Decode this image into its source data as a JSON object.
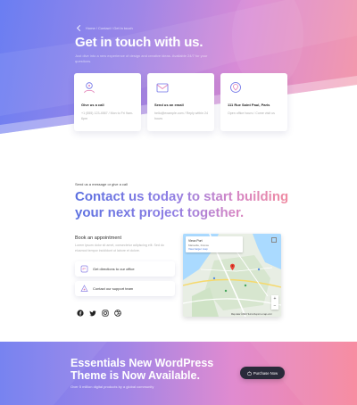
{
  "hero": {
    "breadcrumb": "Home / Contact / Get in touch",
    "title": "Get in touch with us.",
    "subtitle": "Just dive into a new experience of design and creative ideas. Available 24/7 for your questions."
  },
  "cards": [
    {
      "title": "Give us a call",
      "text": "+1 (555) 123-4567 / Mon to Fri 9am-6pm",
      "icon": "phone-user-icon"
    },
    {
      "title": "Send us an email",
      "text": "hello@example.com / Reply within 24 hours",
      "icon": "mail-icon"
    },
    {
      "title": "111 Rue Saint Paul, Paris",
      "text": "Open office hours / Come visit us",
      "icon": "location-globe-icon"
    }
  ],
  "contact": {
    "kicker": "Send us a message or give a call",
    "headline": "Contact us today to start building your next project together.",
    "book_title": "Book an appointment",
    "book_text": "Lorem ipsum dolor sit amet, consectetur adipiscing elit. Sed do eiusmod tempor incididunt ut labore et dolore."
  },
  "actions": [
    {
      "label": "Get directions to our office",
      "icon": "directions-icon"
    },
    {
      "label": "Contact our support team",
      "icon": "support-icon"
    }
  ],
  "socials": [
    "facebook-icon",
    "twitter-icon",
    "instagram-icon",
    "dribbble-icon"
  ],
  "map": {
    "place_name": "Vieux Port",
    "place_address": "Marseille, France",
    "place_link": "View larger map",
    "footer": "Map data ©2024  Terms  Report a map error"
  },
  "banner": {
    "title": "Essentials New WordPress Theme is Now Available.",
    "subtitle": "Over 5 million digital products by a global community",
    "button": "Purchase Now"
  },
  "colors": {
    "accent_blue": "#5a6fe0",
    "accent_pink": "#f08aa0",
    "dark_button": "#2a2a3a"
  }
}
